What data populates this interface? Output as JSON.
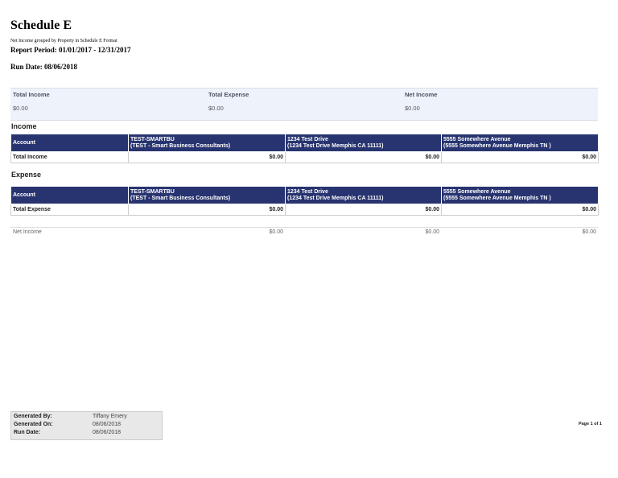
{
  "header": {
    "title": "Schedule E",
    "subtitle": "Net Income grouped by Property in Schedule E Format",
    "period": "Report Period:  01/01/2017 - 12/31/2017",
    "run_date": "Run Date: 08/06/2018"
  },
  "summary": [
    {
      "label": "Total Income",
      "value": "$0.00"
    },
    {
      "label": "Total Expense",
      "value": "$0.00"
    },
    {
      "label": "Net Income",
      "value": "$0.00"
    }
  ],
  "columns": {
    "account": "Account",
    "properties": [
      {
        "code": "TEST-SMARTBU",
        "desc": "(TEST - Smart Business Consultants)"
      },
      {
        "code": "1234 Test Drive",
        "desc": "(1234 Test Drive Memphis CA 11111)"
      },
      {
        "code": "5555 Somewhere Avenue",
        "desc": "(5555 Somewhere Avenue Memphis TN )"
      }
    ]
  },
  "income": {
    "heading": "Income",
    "total_label": "Total Income",
    "totals": [
      "$0.00",
      "$0.00",
      "$0.00"
    ]
  },
  "expense": {
    "heading": "Expense",
    "total_label": "Total Expense",
    "totals": [
      "$0.00",
      "$0.00",
      "$0.00"
    ]
  },
  "net": {
    "label": "Net Income",
    "values": [
      "$0.00",
      "$0.00",
      "$0.00"
    ]
  },
  "footer": {
    "generated_by_label": "Generated By:",
    "generated_by": "Tiffany Emery",
    "generated_on_label": "Generated On:",
    "generated_on": "08/06/2018",
    "run_date_label": "Run Date:",
    "run_date": "08/06/2018",
    "page": "Page 1 of 1"
  }
}
